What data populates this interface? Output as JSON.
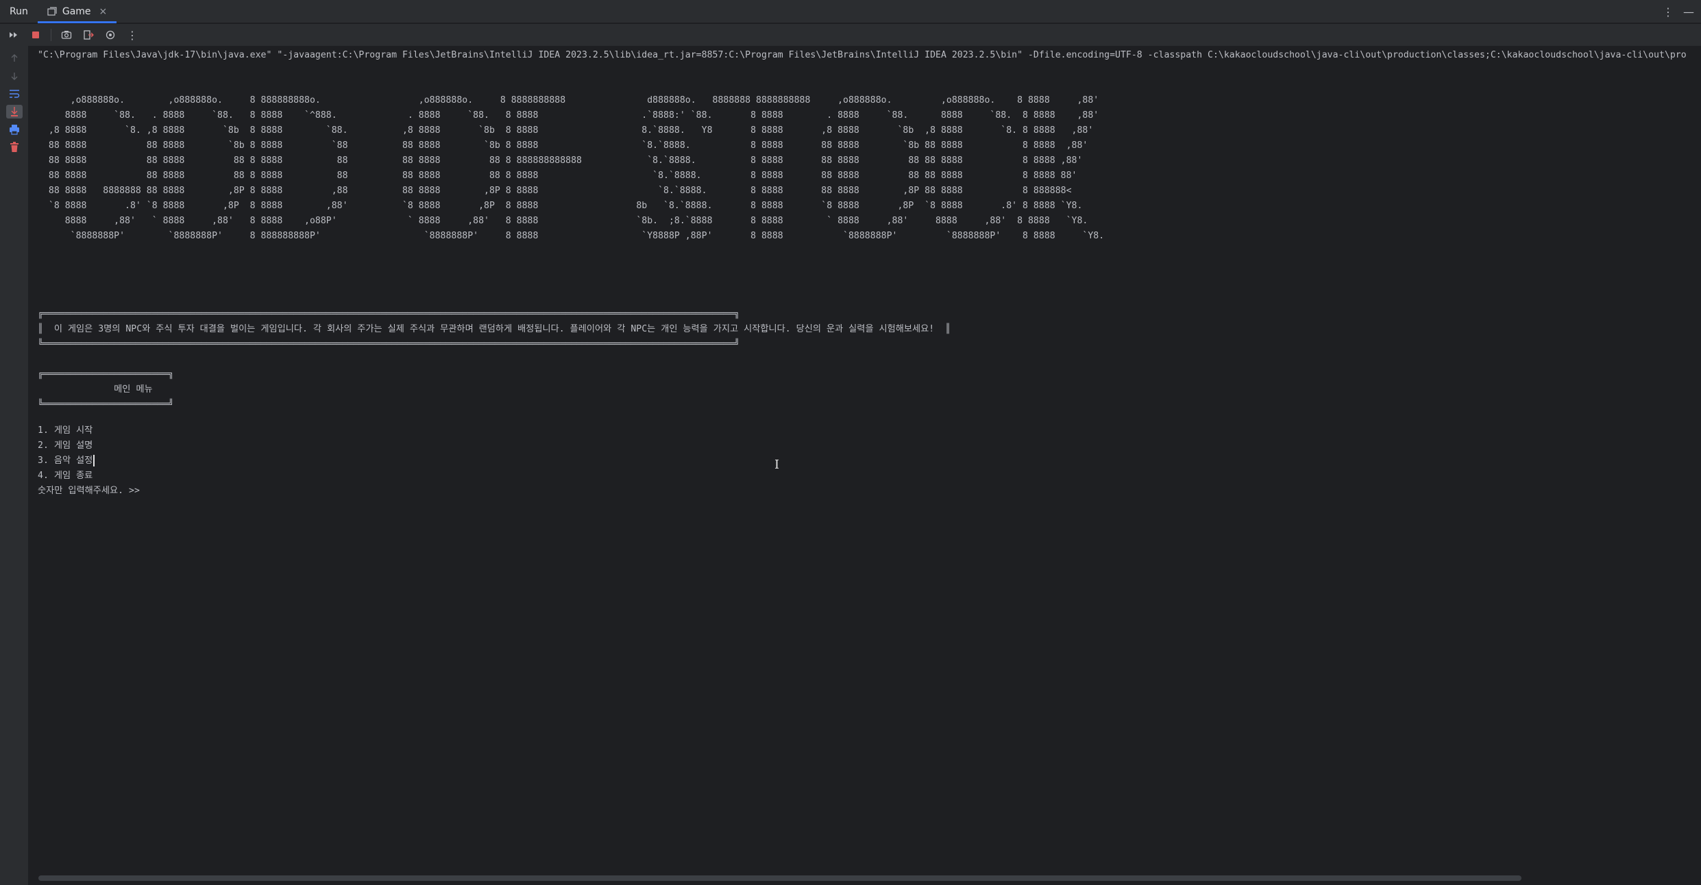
{
  "tool_window": {
    "title": "Run",
    "tab_label": "Game",
    "colors": {
      "accent": "#3574f0",
      "stop": "#db5c5c",
      "bg": "#1e1f22",
      "panel": "#2b2d30"
    }
  },
  "icons": [
    "rerun-icon",
    "stop-icon",
    "screenshot-icon",
    "exit-icon",
    "settings-icon",
    "more-icon",
    "up-icon",
    "down-icon",
    "soft-wrap-icon",
    "scroll-to-end-icon",
    "print-icon",
    "trash-icon"
  ],
  "console": {
    "command": "\"C:\\Program Files\\Java\\jdk-17\\bin\\java.exe\" \"-javaagent:C:\\Program Files\\JetBrains\\IntelliJ IDEA 2023.2.5\\lib\\idea_rt.jar=8857:C:\\Program Files\\JetBrains\\IntelliJ IDEA 2023.2.5\\bin\" -Dfile.encoding=UTF-8 -classpath C:\\kakaocloudschool\\java-cli\\out\\production\\classes;C:\\kakaocloudschool\\java-cli\\out\\pro",
    "ascii_art": "      ,o888888o.        ,o888888o.     8 888888888o.                  ,o888888o.     8 8888888888               d888888o.   8888888 8888888888     ,o888888o.         ,o888888o.    8 8888     ,88'\n     8888     `88.   . 8888     `88.   8 8888    `^888.             . 8888     `88.   8 8888                   .`8888:' `88.       8 8888        . 8888     `88.      8888     `88.  8 8888    ,88'\n  ,8 8888       `8. ,8 8888       `8b  8 8888        `88.          ,8 8888       `8b  8 8888                   8.`8888.   Y8       8 8888       ,8 8888       `8b  ,8 8888       `8. 8 8888   ,88'\n  88 8888           88 8888        `8b 8 8888         `88          88 8888        `8b 8 8888                   `8.`8888.           8 8888       88 8888        `8b 88 8888           8 8888  ,88'\n  88 8888           88 8888         88 8 8888          88          88 8888         88 8 888888888888            `8.`8888.          8 8888       88 8888         88 88 8888           8 8888 ,88'\n  88 8888           88 8888         88 8 8888          88          88 8888         88 8 8888                     `8.`8888.         8 8888       88 8888         88 88 8888           8 8888 88'\n  88 8888   8888888 88 8888        ,8P 8 8888         ,88          88 8888        ,8P 8 8888                      `8.`8888.        8 8888       88 8888        ,8P 88 8888           8 888888<\n  `8 8888       .8' `8 8888       ,8P  8 8888        ,88'          `8 8888       ,8P  8 8888                  8b   `8.`8888.       8 8888       `8 8888       ,8P  `8 8888       .8' 8 8888 `Y8.\n     8888     ,88'   ` 8888     ,88'   8 8888    ,o88P'             ` 8888     ,88'   8 8888                  `8b.  ;8.`8888       8 8888        ` 8888     ,88'     8888     ,88'  8 8888   `Y8.\n      `8888888P'        `8888888P'     8 888888888P'                   `8888888P'     8 8888                   `Y8888P ,88P'       8 8888           `8888888P'         `8888888P'    8 8888     `Y8.",
    "desc_box": {
      "top": "╔═══════════════════════════════════════════════════════════════════════════════════════════════════════════════════════════════╗",
      "text": "║  이 게임은 3명의 NPC와 주식 투자 대결을 벌이는 게임입니다. 각 회사의 주가는 실제 주식과 무관하며 랜덤하게 배정됩니다. 플레이어와 각 NPC는 개인 능력을 가지고 시작합니다. 당신의 운과 실력을 시험해보세요!  ║",
      "bottom": "╚═══════════════════════════════════════════════════════════════════════════════════════════════════════════════════════════════╝"
    },
    "menu_box": {
      "top": "╔═══════════════════════╗",
      "title": "              메인 메뉴",
      "bottom": "╚═══════════════════════╝"
    },
    "menu_items": [
      "1. 게임 시작",
      "2. 게임 설명",
      "3. 음악 설정",
      "4. 게임 종료"
    ],
    "prompt": "숫자만 입력해주세요. >>"
  }
}
